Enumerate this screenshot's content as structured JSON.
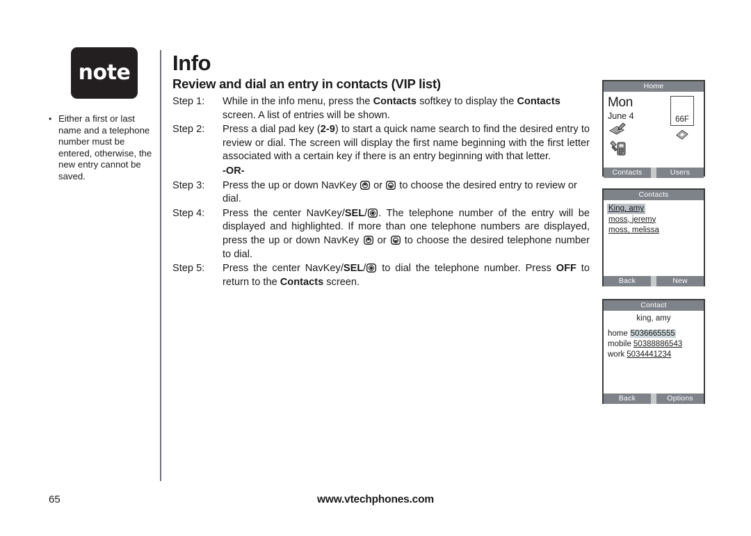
{
  "note": {
    "badge_label": "note",
    "bullets": [
      "Either a first or last name and a telephone number must be entered, otherwise, the new entry cannot be saved."
    ]
  },
  "main": {
    "page_title": "Info",
    "section_heading": "Review and dial an entry in contacts (VIP list)",
    "or_separator": "-OR-",
    "steps": [
      {
        "label": "Step 1:",
        "text_html": "While in the info menu, press the <b>Contacts</b> softkey to display the <b>Contacts</b> screen. A list of entries will be shown."
      },
      {
        "label": "Step 2:",
        "text_html": "Press a dial pad key (<b>2-9</b>) to start a quick name search to find the desired entry to review or dial. The screen will display the first name beginning with the first letter associated with a certain key if there is an entry beginning with that letter."
      },
      {
        "label": "Step 3:",
        "text_html": "Press the up or down NavKey [UP] or [DOWN] to choose the desired entry to review or dial."
      },
      {
        "label": "Step 4:",
        "text_html": "Press the center NavKey/<b>SEL</b>/[SEL]. The telephone number of the entry will be displayed and highlighted. If more than one telephone numbers are displayed, press the up or down NavKey [UP] or [DOWN] to choose the desired telephone number to dial."
      },
      {
        "label": "Step 5:",
        "text_html": "Press the center NavKey/<b>SEL</b>/[SEL] to dial the telephone number. Press <b>OFF</b> to return to the <b>Contacts</b> screen."
      }
    ]
  },
  "screens": {
    "home": {
      "title": "Home",
      "day": "Mon",
      "date": "June 4",
      "temperature": "66F",
      "softkey_left": "Contacts",
      "softkey_right": "Users",
      "icons": [
        "notepad-pen-icon",
        "handset-tool-icon",
        "diamond-icon"
      ]
    },
    "contacts": {
      "title": "Contacts",
      "entries": [
        {
          "name": "King, amy",
          "selected": true
        },
        {
          "name": "moss, jeremy",
          "selected": false
        },
        {
          "name": "moss, melissa",
          "selected": false
        }
      ],
      "softkey_left": "Back",
      "softkey_right": "New"
    },
    "contact": {
      "title": "Contact",
      "name": "king, amy",
      "numbers": [
        {
          "label": "home",
          "value": "5036665555",
          "highlighted": true
        },
        {
          "label": "mobile",
          "value": "50388886543",
          "highlighted": false
        },
        {
          "label": "work",
          "value": "5034441234",
          "highlighted": false
        }
      ],
      "softkey_left": "Back",
      "softkey_right": "Options"
    }
  },
  "footer": {
    "page_number": "65",
    "url": "www.vtechphones.com"
  },
  "colors": {
    "badge_bg": "#231f20",
    "screen_titlebar": "#7e838a",
    "screen_border": "#3b3b3b",
    "softkey_bg": "#7e838a",
    "softkey_tray": "#c9c9c9",
    "highlight": "#b9c0c6",
    "rule": "#6d7279"
  }
}
